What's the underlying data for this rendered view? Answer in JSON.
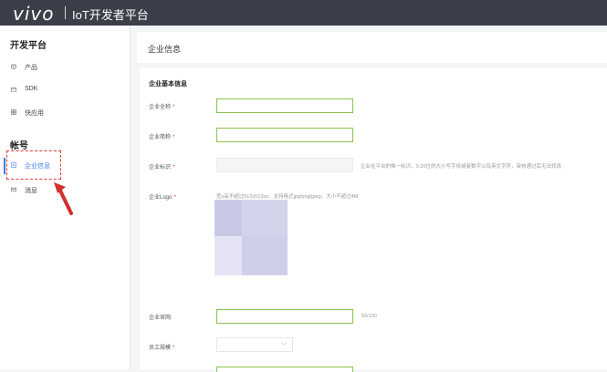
{
  "header": {
    "brand": "vivo",
    "title": "IoT开发者平台"
  },
  "sidebar": {
    "section1_title": "开发平台",
    "items1": [
      {
        "label": "产品",
        "icon": "cube-icon"
      },
      {
        "label": "SDK",
        "icon": "box-icon"
      },
      {
        "label": "快应用",
        "icon": "grid-icon"
      }
    ],
    "section2_title": "帐号",
    "items2": [
      {
        "label": "企业信息",
        "icon": "document-icon",
        "active": true
      },
      {
        "label": "消息",
        "icon": "mail-icon"
      }
    ]
  },
  "main": {
    "page_title": "企业信息",
    "section_title": "企业基本信息",
    "fields": {
      "full_name": "企业全称",
      "short_name": "企业简称",
      "identifier": "企业标识",
      "identifier_hint": "企业在平台的唯一标识，3-20位的大小写字母或者数字以及英文字符，审核通过后无法修改",
      "logo": "企业Logo",
      "logo_hint": "宽x高不超过512x512px，支持格式jpg/png/jpeg，大小不超过4M",
      "website": "企业官网",
      "website_counter": "50/100",
      "employees": "员工规模"
    }
  },
  "colors": {
    "topbar": "#3b3f49",
    "accent": "#3c7be6",
    "valid_border": "#8bc34a",
    "required": "#e53935"
  }
}
